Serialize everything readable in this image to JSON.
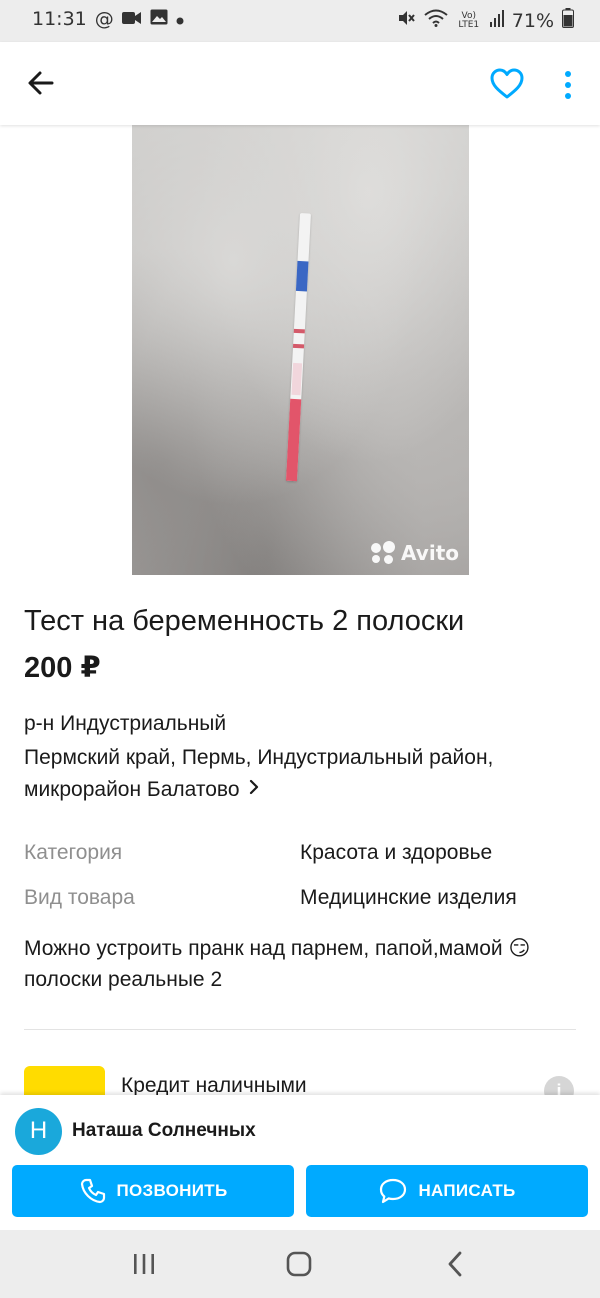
{
  "status_bar": {
    "time": "11:31",
    "battery": "71%",
    "network_label": "Vo) LTE1"
  },
  "app_bar": {
    "back_icon": "arrow-left-icon",
    "favorite_icon": "heart-outline-icon",
    "menu_icon": "more-vert-icon",
    "accent_color": "#00aaff"
  },
  "photo": {
    "watermark": "Avito"
  },
  "listing": {
    "title": "Тест на беременность 2 полоски",
    "price": "200 ₽",
    "district": "р-н Индустриальный",
    "address": "Пермский край, Пермь, Индустриальный район, микрорайон Балатово",
    "specs": [
      {
        "label": "Категория",
        "value": "Красота и здоровье"
      },
      {
        "label": "Вид товара",
        "value": "Медицинские изделия"
      }
    ],
    "description": "Можно устроить пранк над парнем, папой,мамой 😏полоски реальные 2"
  },
  "promo": {
    "title": "Кредит наличными",
    "info_icon": "i"
  },
  "seller": {
    "initial": "Н",
    "name": "Наташа Солнечных",
    "avatar_color": "#1aa8db"
  },
  "actions": {
    "call_label": "ПОЗВОНИТЬ",
    "write_label": "НАПИСАТЬ",
    "button_color": "#00aaff"
  },
  "nav_bar": {
    "recent_icon": "recent-apps-icon",
    "home_icon": "home-icon",
    "back_icon": "back-chevron-icon"
  }
}
